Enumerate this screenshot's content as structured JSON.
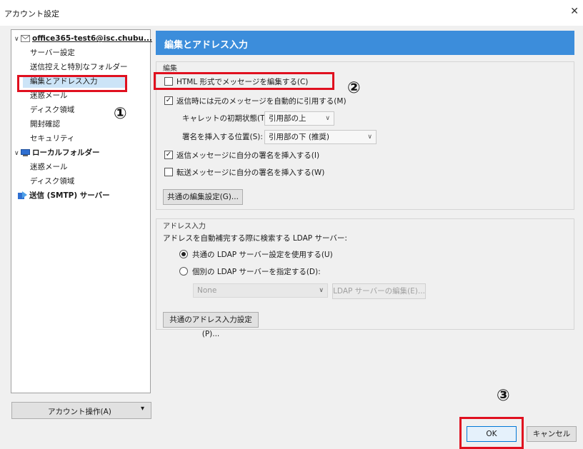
{
  "window": {
    "title": "アカウント設定",
    "close_glyph": "✕"
  },
  "tree": {
    "account": "office365-test6@isc.chubu...",
    "account_items": [
      "サーバー設定",
      "送信控えと特別なフォルダー",
      "編集とアドレス入力",
      "迷惑メール",
      "ディスク領域",
      "開封確認",
      "セキュリティ"
    ],
    "local_folder": "ローカルフォルダー",
    "local_items": [
      "迷惑メール",
      "ディスク領域"
    ],
    "smtp": "送信 (SMTP) サーバー",
    "selected_index": 2
  },
  "account_actions": {
    "label": "アカウント操作(A)",
    "arrow": "▾"
  },
  "panel": {
    "title": "編集とアドレス入力",
    "compose": {
      "group_title": "編集",
      "html_checkbox": {
        "label": "HTML 形式でメッセージを編集する(C)",
        "checked": false
      },
      "quote_checkbox": {
        "label": "返信時には元のメッセージを自動的に引用する(M)",
        "checked": true
      },
      "caret_label": "キャレットの初期状態(T):",
      "caret_value": "引用部の上",
      "sig_label": "署名を挿入する位置(S):",
      "sig_value": "引用部の下 (推奨)",
      "reply_sig": {
        "label": "返信メッセージに自分の署名を挿入する(I)",
        "checked": true
      },
      "forward_sig": {
        "label": "転送メッセージに自分の署名を挿入する(W)",
        "checked": false
      },
      "global_button": "共通の編集設定(G)..."
    },
    "address": {
      "group_title": "アドレス入力",
      "ldap_desc": "アドレスを自動補完する際に検索する LDAP サーバー:",
      "use_global": {
        "label": "共通の LDAP サーバー設定を使用する(U)",
        "selected": true
      },
      "use_specific": {
        "label": "個別の LDAP サーバーを指定する(D):",
        "selected": false
      },
      "ldap_select": "None",
      "ldap_edit": "LDAP サーバーの編集(E)...",
      "global_button": "共通のアドレス入力設定(P)..."
    }
  },
  "annotations": {
    "one": "①",
    "two": "②",
    "three": "③",
    "color": "#e0101f"
  },
  "footer": {
    "ok": "OK",
    "cancel": "キャンセル"
  },
  "colors": {
    "header": "#3c8ddb",
    "selection": "#cce4f7"
  }
}
